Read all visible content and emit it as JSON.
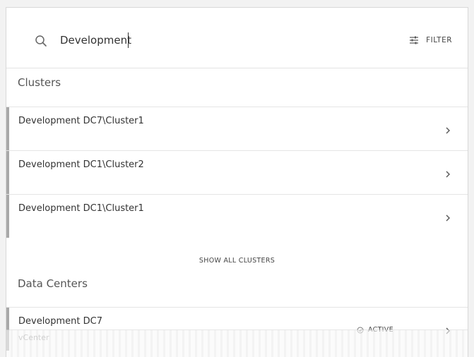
{
  "search": {
    "value": "Development",
    "filter_label": "FILTER"
  },
  "clusters": {
    "title": "Clusters",
    "items": [
      {
        "label": "Development DC7\\Cluster1"
      },
      {
        "label": "Development DC1\\Cluster2"
      },
      {
        "label": "Development DC1\\Cluster1"
      }
    ],
    "show_all_label": "SHOW ALL CLUSTERS"
  },
  "datacenters": {
    "title": "Data Centers",
    "items": [
      {
        "label": "Development DC7",
        "sublabel": "vCenter",
        "status": "ACTIVE"
      }
    ]
  },
  "colors": {
    "row_bar": "#a8a8a8",
    "text": "#333333",
    "muted": "#999999"
  }
}
